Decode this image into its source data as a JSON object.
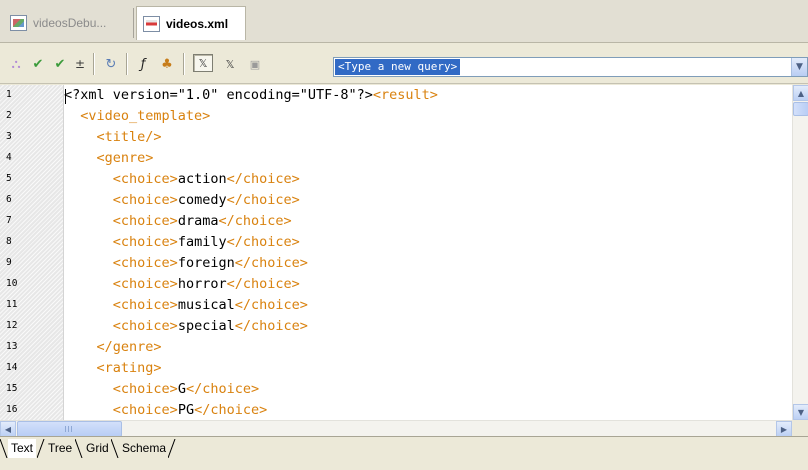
{
  "file_tabs": [
    {
      "label": "videosDebu...",
      "active": false,
      "icon": "project-file-icon"
    },
    {
      "label": "videos.xml",
      "active": true,
      "icon": "xml-file-icon"
    }
  ],
  "toolbar": {
    "query_placeholder": "<Type a new query>",
    "icons": [
      "xpath-icon",
      "validate-icon",
      "validate-all-icon",
      "indent-icon",
      "refresh-icon",
      "function-icon",
      "namespace-icon",
      "xpath-1-icon",
      "xpath-2-icon",
      "evaluate-icon"
    ]
  },
  "editor": {
    "lines": [
      {
        "num": "1",
        "segments": [
          {
            "t": "q",
            "s": "<?xml version=\"1.0\" encoding=\"UTF-8\"?>"
          },
          {
            "t": "t",
            "s": "<result>"
          }
        ]
      },
      {
        "num": "2",
        "segments": [
          {
            "t": "v",
            "s": "  "
          },
          {
            "t": "t",
            "s": "<video_template>"
          }
        ]
      },
      {
        "num": "3",
        "segments": [
          {
            "t": "v",
            "s": "    "
          },
          {
            "t": "t",
            "s": "<title/>"
          }
        ]
      },
      {
        "num": "4",
        "segments": [
          {
            "t": "v",
            "s": "    "
          },
          {
            "t": "t",
            "s": "<genre>"
          }
        ]
      },
      {
        "num": "5",
        "segments": [
          {
            "t": "v",
            "s": "      "
          },
          {
            "t": "t",
            "s": "<choice>"
          },
          {
            "t": "v",
            "s": "action"
          },
          {
            "t": "t",
            "s": "</choice>"
          }
        ]
      },
      {
        "num": "6",
        "segments": [
          {
            "t": "v",
            "s": "      "
          },
          {
            "t": "t",
            "s": "<choice>"
          },
          {
            "t": "v",
            "s": "comedy"
          },
          {
            "t": "t",
            "s": "</choice>"
          }
        ]
      },
      {
        "num": "7",
        "segments": [
          {
            "t": "v",
            "s": "      "
          },
          {
            "t": "t",
            "s": "<choice>"
          },
          {
            "t": "v",
            "s": "drama"
          },
          {
            "t": "t",
            "s": "</choice>"
          }
        ]
      },
      {
        "num": "8",
        "segments": [
          {
            "t": "v",
            "s": "      "
          },
          {
            "t": "t",
            "s": "<choice>"
          },
          {
            "t": "v",
            "s": "family"
          },
          {
            "t": "t",
            "s": "</choice>"
          }
        ]
      },
      {
        "num": "9",
        "segments": [
          {
            "t": "v",
            "s": "      "
          },
          {
            "t": "t",
            "s": "<choice>"
          },
          {
            "t": "v",
            "s": "foreign"
          },
          {
            "t": "t",
            "s": "</choice>"
          }
        ]
      },
      {
        "num": "10",
        "segments": [
          {
            "t": "v",
            "s": "      "
          },
          {
            "t": "t",
            "s": "<choice>"
          },
          {
            "t": "v",
            "s": "horror"
          },
          {
            "t": "t",
            "s": "</choice>"
          }
        ]
      },
      {
        "num": "11",
        "segments": [
          {
            "t": "v",
            "s": "      "
          },
          {
            "t": "t",
            "s": "<choice>"
          },
          {
            "t": "v",
            "s": "musical"
          },
          {
            "t": "t",
            "s": "</choice>"
          }
        ]
      },
      {
        "num": "12",
        "segments": [
          {
            "t": "v",
            "s": "      "
          },
          {
            "t": "t",
            "s": "<choice>"
          },
          {
            "t": "v",
            "s": "special"
          },
          {
            "t": "t",
            "s": "</choice>"
          }
        ]
      },
      {
        "num": "13",
        "segments": [
          {
            "t": "v",
            "s": "    "
          },
          {
            "t": "t",
            "s": "</genre>"
          }
        ]
      },
      {
        "num": "14",
        "segments": [
          {
            "t": "v",
            "s": "    "
          },
          {
            "t": "t",
            "s": "<rating>"
          }
        ]
      },
      {
        "num": "15",
        "segments": [
          {
            "t": "v",
            "s": "      "
          },
          {
            "t": "t",
            "s": "<choice>"
          },
          {
            "t": "v",
            "s": "G"
          },
          {
            "t": "t",
            "s": "</choice>"
          }
        ]
      },
      {
        "num": "16",
        "segments": [
          {
            "t": "v",
            "s": "      "
          },
          {
            "t": "t",
            "s": "<choice>"
          },
          {
            "t": "v",
            "s": "PG"
          },
          {
            "t": "t",
            "s": "</choice>"
          }
        ]
      }
    ]
  },
  "view_tabs": [
    {
      "label": "Text",
      "active": true
    },
    {
      "label": "Tree",
      "active": false
    },
    {
      "label": "Grid",
      "active": false
    },
    {
      "label": "Schema",
      "active": false
    }
  ],
  "colors": {
    "tag": "#d9820f",
    "text": "#000000",
    "selection": "#316ac5"
  }
}
